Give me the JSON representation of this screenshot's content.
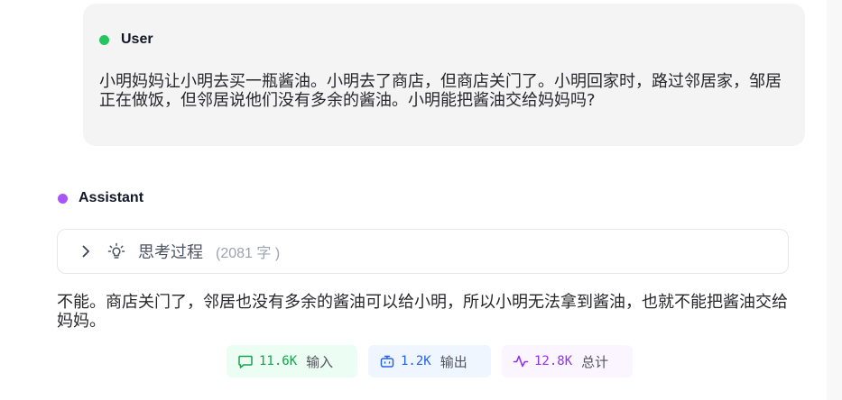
{
  "colors": {
    "user_dot": "#22c55e",
    "assistant_dot": "#a855f7",
    "input_accent": "#16a34a",
    "output_accent": "#2563eb",
    "total_accent": "#9333ea"
  },
  "user_message": {
    "role": "User",
    "text": "小明妈妈让小明去买一瓶酱油。小明去了商店，但商店关门了。小明回家时，路过邻居家，邹居正在做饭，但邻居说他们没有多余的酱油。小明能把酱油交给妈妈吗?"
  },
  "assistant_message": {
    "role": "Assistant",
    "thinking": {
      "title": "思考过程",
      "count": "(2081 字 )",
      "chevron_icon": "chevron-right-icon",
      "bulb_icon": "lightbulb-icon"
    },
    "answer": "不能。商店关门了，邻居也没有多余的酱油可以给小明，所以小明无法拿到酱油，也就不能把酱油交给妈妈。"
  },
  "stats": {
    "input": {
      "value": "11.6K",
      "label": "输入",
      "icon": "message-square-icon"
    },
    "output": {
      "value": "1.2K",
      "label": "输出",
      "icon": "bot-icon"
    },
    "total": {
      "value": "12.8K",
      "label": "总计",
      "icon": "activity-icon"
    }
  }
}
